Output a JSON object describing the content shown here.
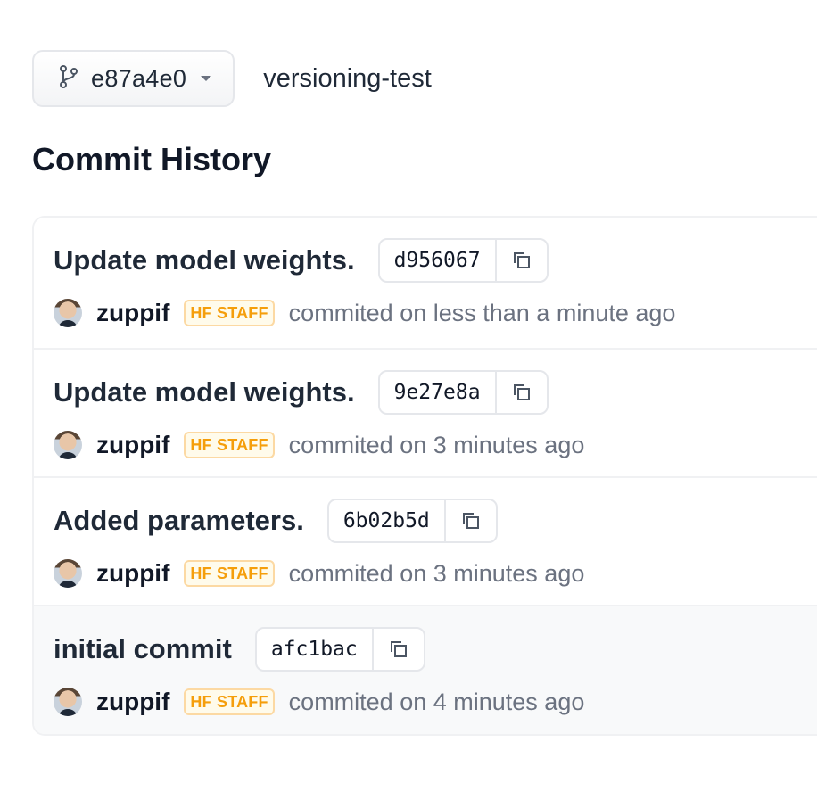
{
  "branch": {
    "label": "e87a4e0",
    "icon": "git-branch-icon"
  },
  "repo": {
    "name": "versioning-test"
  },
  "heading": "Commit History",
  "commits": [
    {
      "title": "Update model weights.",
      "hash": "d956067",
      "author": "zuppif",
      "badge": "HF STAFF",
      "time": "commited on less than a minute ago"
    },
    {
      "title": "Update model weights.",
      "hash": "9e27e8a",
      "author": "zuppif",
      "badge": "HF STAFF",
      "time": "commited on 3 minutes ago"
    },
    {
      "title": "Added parameters.",
      "hash": "6b02b5d",
      "author": "zuppif",
      "badge": "HF STAFF",
      "time": "commited on 3 minutes ago"
    },
    {
      "title": "initial commit",
      "hash": "afc1bac",
      "author": "zuppif",
      "badge": "HF STAFF",
      "time": "commited on 4 minutes ago"
    }
  ],
  "colors": {
    "badge_text": "#f59e0b",
    "badge_border": "#fcd9a3",
    "meta_text": "#6b7280"
  }
}
